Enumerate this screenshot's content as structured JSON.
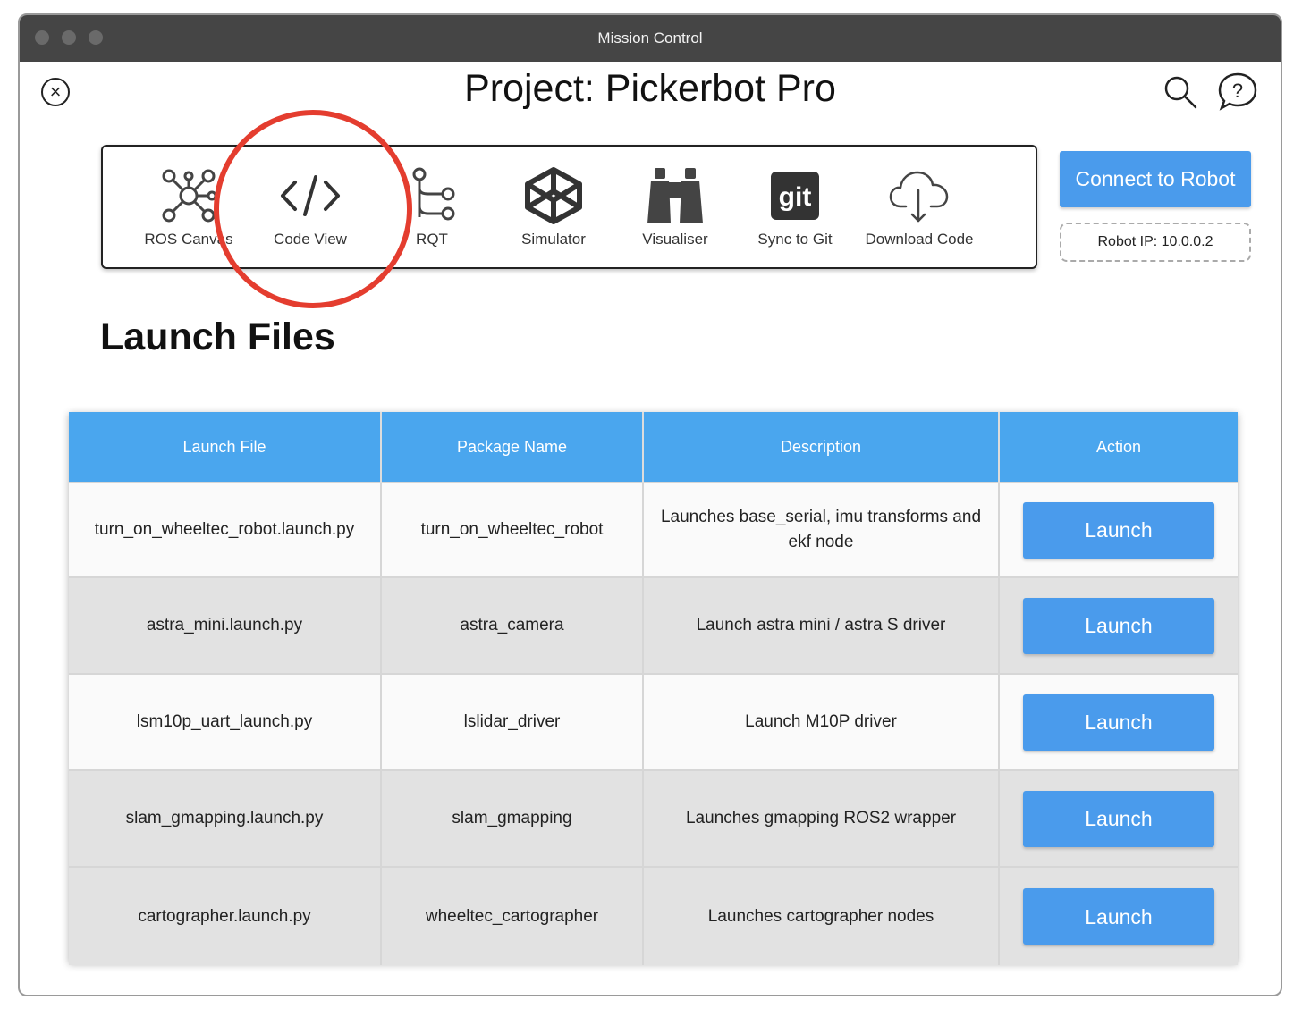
{
  "window": {
    "title": "Mission Control"
  },
  "header": {
    "project_title": "Project: Pickerbot Pro"
  },
  "toolbar": {
    "items": [
      {
        "label": "ROS Canvas",
        "icon": "network-graph-icon"
      },
      {
        "label": "Code View",
        "icon": "code-brackets-icon"
      },
      {
        "label": "RQT",
        "icon": "tree-graph-icon"
      },
      {
        "label": "Simulator",
        "icon": "cube-box-icon"
      },
      {
        "label": "Visualiser",
        "icon": "binoculars-icon"
      },
      {
        "label": "Sync to Git",
        "icon": "git-logo-icon"
      },
      {
        "label": "Download Code",
        "icon": "cloud-download-icon"
      }
    ]
  },
  "connection": {
    "connect_label": "Connect to Robot",
    "robot_ip": "Robot IP: 10.0.0.2"
  },
  "section": {
    "title": "Launch Files"
  },
  "table": {
    "headers": [
      "Launch File",
      "Package Name",
      "Description",
      "Action"
    ],
    "rows": [
      {
        "file": "turn_on_wheeltec_robot.launch.py",
        "package": "turn_on_wheeltec_robot",
        "description": "Launches base_serial, imu transforms and ekf node",
        "action": "Launch"
      },
      {
        "file": "astra_mini.launch.py",
        "package": "astra_camera",
        "description": "Launch astra mini / astra S driver",
        "action": "Launch"
      },
      {
        "file": "lsm10p_uart_launch.py",
        "package": "lslidar_driver",
        "description": "Launch M10P driver",
        "action": "Launch"
      },
      {
        "file": "slam_gmapping.launch.py",
        "package": "slam_gmapping",
        "description": "Launches gmapping ROS2 wrapper",
        "action": "Launch"
      },
      {
        "file": "cartographer.launch.py",
        "package": "wheeltec_cartographer",
        "description": "Launches cartographer nodes",
        "action": "Launch"
      }
    ]
  },
  "colors": {
    "accent": "#4a9bec",
    "header": "#4aa6ee",
    "highlight": "#e43d2f"
  }
}
